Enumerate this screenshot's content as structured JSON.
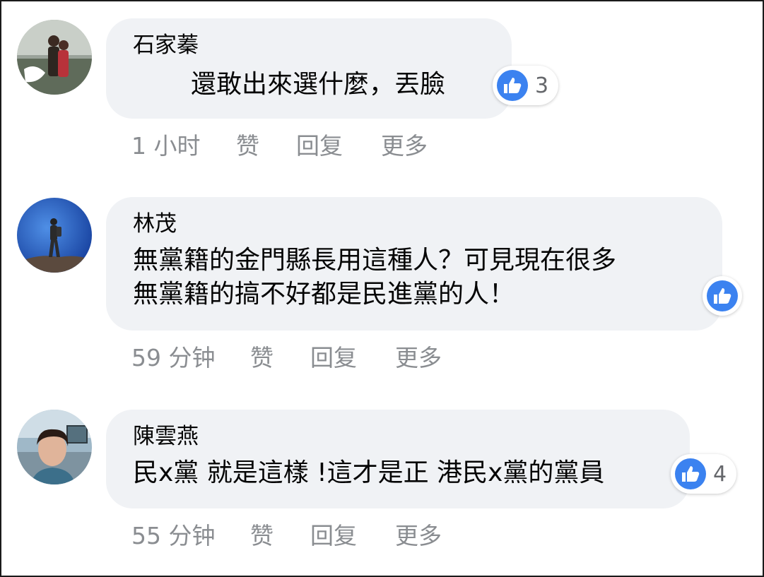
{
  "comments": [
    {
      "author": "石家蓁",
      "text_lines": [
        "還敢出來選什麼，丟臉"
      ],
      "reaction_count": "3",
      "time": "1 小时",
      "like_label": "赞",
      "reply_label": "回复",
      "more_label": "更多"
    },
    {
      "author": "林茂",
      "text_lines": [
        "無黨籍的金門縣長用這種人？可見現在很多",
        "無黨籍的搞不好都是民進黨的人！"
      ],
      "reaction_count": "",
      "time": "59 分钟",
      "like_label": "赞",
      "reply_label": "回复",
      "more_label": "更多"
    },
    {
      "author": "陳雲燕",
      "text_lines": [
        "民x黨 就是這樣 !這才是正 港民x黨的黨員"
      ],
      "reaction_count": "4",
      "time": "55 分钟",
      "like_label": "赞",
      "reply_label": "回复",
      "more_label": "更多"
    }
  ],
  "colors": {
    "bubble_bg": "#f0f2f5",
    "like_blue": "#3b82f0",
    "meta_text": "#8a8d91"
  },
  "icons": {
    "reaction": "thumbs-up-icon"
  }
}
